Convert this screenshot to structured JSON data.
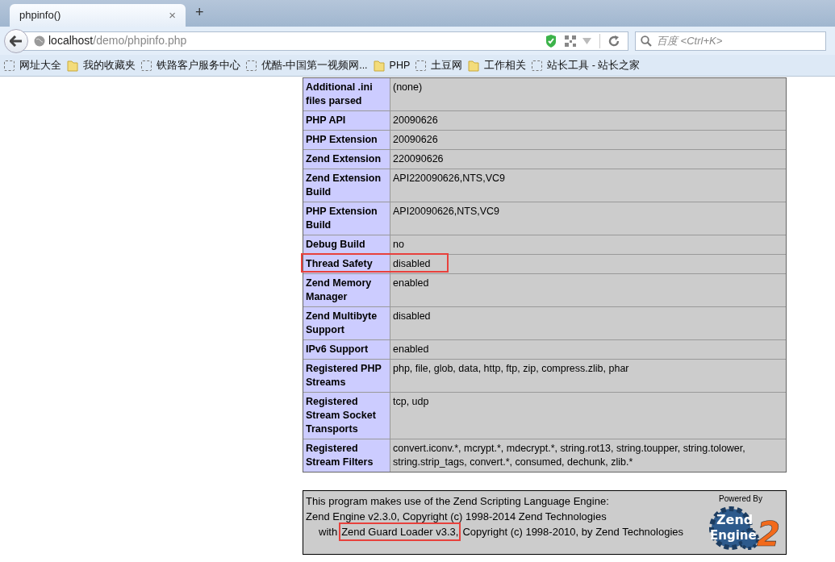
{
  "browser": {
    "tab": {
      "title": "phpinfo()",
      "close": "×"
    },
    "new_tab": "+",
    "address": {
      "host": "localhost",
      "path": "/demo/phpinfo.php"
    },
    "search": {
      "placeholder": "百度 <Ctrl+K>"
    },
    "bookmarks": [
      {
        "label": "网址大全",
        "kind": "page"
      },
      {
        "label": "我的收藏夹",
        "kind": "folder"
      },
      {
        "label": "铁路客户服务中心",
        "kind": "page"
      },
      {
        "label": "优酷-中国第一视频网...",
        "kind": "page"
      },
      {
        "label": "PHP",
        "kind": "folder"
      },
      {
        "label": "土豆网",
        "kind": "page"
      },
      {
        "label": "工作相关",
        "kind": "folder"
      },
      {
        "label": "站长工具 - 站长之家",
        "kind": "page"
      }
    ]
  },
  "table": {
    "rows": [
      {
        "label": "Additional .ini files parsed",
        "value": "(none)",
        "highlighted": false
      },
      {
        "label": "PHP API",
        "value": "20090626",
        "highlighted": false
      },
      {
        "label": "PHP Extension",
        "value": "20090626",
        "highlighted": false
      },
      {
        "label": "Zend Extension",
        "value": "220090626",
        "highlighted": false
      },
      {
        "label": "Zend Extension Build",
        "value": "API220090626,NTS,VC9",
        "highlighted": false
      },
      {
        "label": "PHP Extension Build",
        "value": "API20090626,NTS,VC9",
        "highlighted": false
      },
      {
        "label": "Debug Build",
        "value": "no",
        "highlighted": false
      },
      {
        "label": "Thread Safety",
        "value": "disabled",
        "highlighted": true
      },
      {
        "label": "Zend Memory Manager",
        "value": "enabled",
        "highlighted": false
      },
      {
        "label": "Zend Multibyte Support",
        "value": "disabled",
        "highlighted": false
      },
      {
        "label": "IPv6 Support",
        "value": "enabled",
        "highlighted": false
      },
      {
        "label": "Registered PHP Streams",
        "value": "php, file, glob, data, http, ftp, zip, compress.zlib, phar",
        "highlighted": false
      },
      {
        "label": "Registered Stream Socket Transports",
        "value": "tcp, udp",
        "highlighted": false
      },
      {
        "label": "Registered Stream Filters",
        "value": "convert.iconv.*, mcrypt.*, mdecrypt.*, string.rot13, string.toupper, string.tolower, string.strip_tags, convert.*, consumed, dechunk, zlib.*",
        "highlighted": false
      }
    ]
  },
  "footer": {
    "lines": [
      {
        "parts": [
          {
            "text": "This program makes use of the Zend Scripting Language Engine:",
            "highlighted": false
          }
        ]
      },
      {
        "parts": [
          {
            "text": "Zend Engine v2.3.0, Copyright (c) 1998-2014 Zend Technologies",
            "highlighted": false
          }
        ]
      },
      {
        "parts": [
          {
            "text": "with",
            "highlighted": false
          },
          {
            "text": "Zend Guard Loader v3.3,",
            "highlighted": true
          },
          {
            "text": "Copyright (c) 1998-2010, by Zend Technologies",
            "highlighted": false
          }
        ]
      }
    ],
    "logo": {
      "caption": "Powered By",
      "word1": "Zend",
      "word2": "Engine",
      "mark": "2"
    }
  }
}
